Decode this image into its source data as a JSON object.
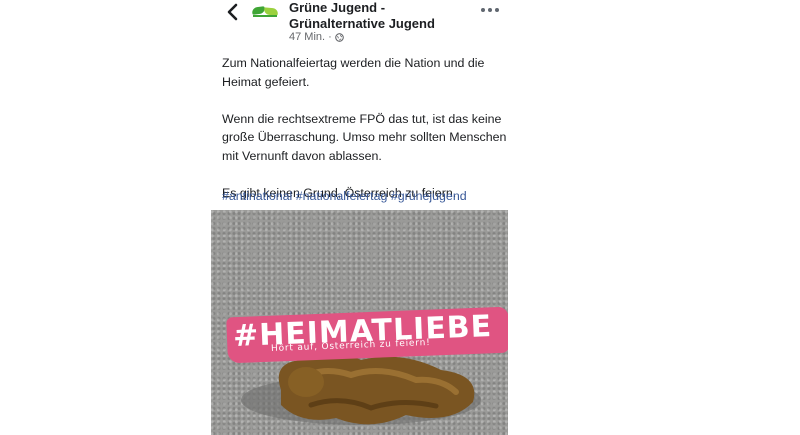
{
  "header": {
    "page_name_line1": "Grüne Jugend -",
    "page_name_line2": "Grünalternative Jugend",
    "timestamp": "47 Min.",
    "separator": "·"
  },
  "post": {
    "paragraphs": [
      "Zum Nationalfeiertag werden die Nation und die Heimat gefeiert.",
      "Wenn die rechtsextreme FPÖ das tut, ist das keine große Überraschung. Umso mehr sollten Menschen mit Vernunft davon ablassen.",
      "Es gibt keinen Grund, Österreich zu feiern."
    ],
    "hashtags": [
      "#antinational",
      "#nationalfeiertag",
      "#grünejugend"
    ]
  },
  "image": {
    "banner_title": "#HEIMATLIEBE",
    "banner_subtitle": "Hört auf, Österreich zu feiern!",
    "banner_color": "#e05482"
  },
  "icons": {
    "back": "chevron-left-icon",
    "more": "more-options-icon",
    "privacy": "globe-icon"
  }
}
